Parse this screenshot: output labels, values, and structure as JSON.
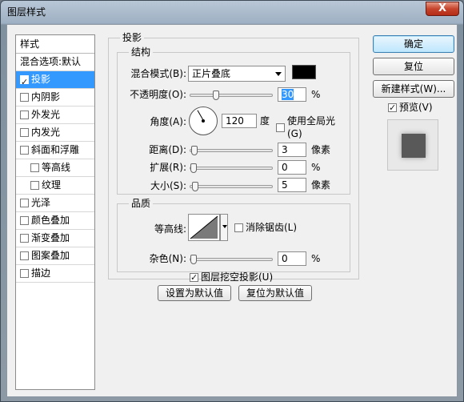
{
  "window": {
    "title": "图层样式",
    "close_label": "X"
  },
  "styles_list": {
    "header": "样式",
    "items": [
      {
        "label": "混合选项:默认",
        "has_checkbox": false,
        "checked": false,
        "selected": false,
        "sub": false
      },
      {
        "label": "投影",
        "has_checkbox": true,
        "checked": true,
        "selected": true,
        "sub": false
      },
      {
        "label": "内阴影",
        "has_checkbox": true,
        "checked": false,
        "selected": false,
        "sub": false
      },
      {
        "label": "外发光",
        "has_checkbox": true,
        "checked": false,
        "selected": false,
        "sub": false
      },
      {
        "label": "内发光",
        "has_checkbox": true,
        "checked": false,
        "selected": false,
        "sub": false
      },
      {
        "label": "斜面和浮雕",
        "has_checkbox": true,
        "checked": false,
        "selected": false,
        "sub": false
      },
      {
        "label": "等高线",
        "has_checkbox": true,
        "checked": false,
        "selected": false,
        "sub": true
      },
      {
        "label": "纹理",
        "has_checkbox": true,
        "checked": false,
        "selected": false,
        "sub": true
      },
      {
        "label": "光泽",
        "has_checkbox": true,
        "checked": false,
        "selected": false,
        "sub": false
      },
      {
        "label": "颜色叠加",
        "has_checkbox": true,
        "checked": false,
        "selected": false,
        "sub": false
      },
      {
        "label": "渐变叠加",
        "has_checkbox": true,
        "checked": false,
        "selected": false,
        "sub": false
      },
      {
        "label": "图案叠加",
        "has_checkbox": true,
        "checked": false,
        "selected": false,
        "sub": false
      },
      {
        "label": "描边",
        "has_checkbox": true,
        "checked": false,
        "selected": false,
        "sub": false
      }
    ]
  },
  "drop_shadow": {
    "title": "投影",
    "structure": {
      "title": "结构",
      "blend_mode": {
        "label": "混合模式(B):",
        "value": "正片叠底",
        "color": "#000000"
      },
      "opacity": {
        "label": "不透明度(O):",
        "value": "30",
        "unit": "%",
        "fraction": 0.3
      },
      "angle": {
        "label": "角度(A):",
        "value": "120",
        "unit": "度",
        "degrees": 120,
        "global_light_label": "使用全局光(G)",
        "global_light_checked": false
      },
      "distance": {
        "label": "距离(D):",
        "value": "3",
        "unit": "像素",
        "fraction": 0.01
      },
      "spread": {
        "label": "扩展(R):",
        "value": "0",
        "unit": "%",
        "fraction": 0
      },
      "size": {
        "label": "大小(S):",
        "value": "5",
        "unit": "像素",
        "fraction": 0.02
      }
    },
    "quality": {
      "title": "品质",
      "contour_label": "等高线:",
      "anti_alias_label": "消除锯齿(L)",
      "anti_alias_checked": false,
      "noise": {
        "label": "杂色(N):",
        "value": "0",
        "unit": "%",
        "fraction": 0
      }
    },
    "knockout_label": "图层挖空投影(U)",
    "knockout_checked": true,
    "make_default_label": "设置为默认值",
    "reset_default_label": "复位为默认值"
  },
  "buttons": {
    "ok": "确定",
    "reset": "复位",
    "new_style": "新建样式(W)...",
    "preview_label": "预览(V)",
    "preview_checked": true
  }
}
